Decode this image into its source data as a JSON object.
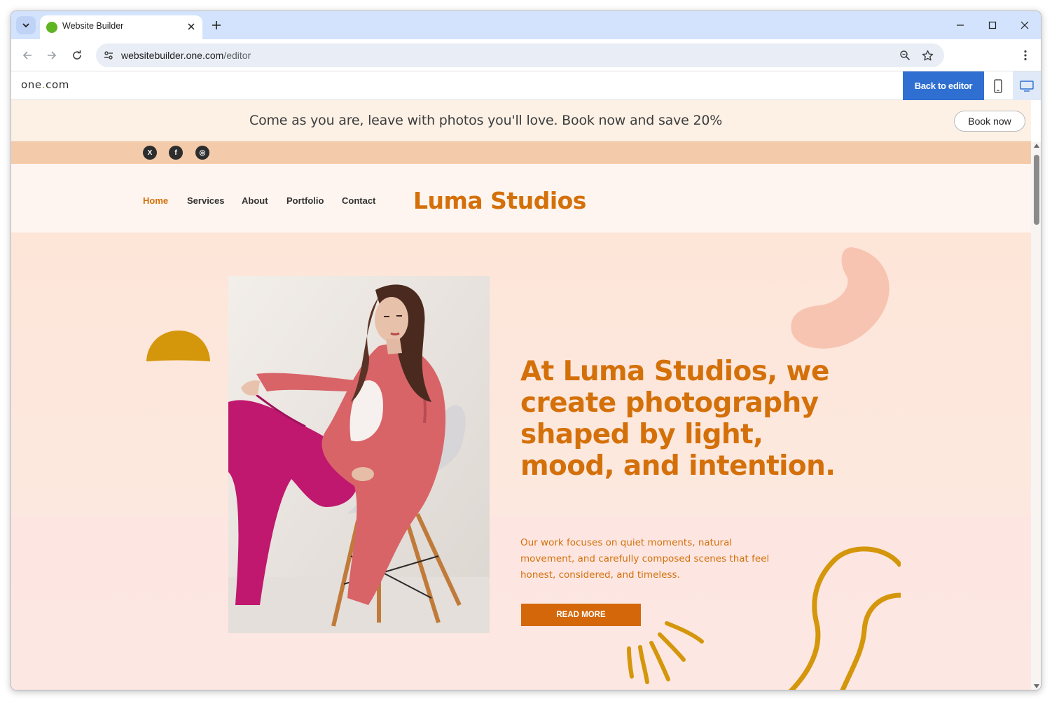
{
  "browser": {
    "tab_title": "Website Builder",
    "url_host": "websitebuilder.one.com",
    "url_path": "/editor"
  },
  "editor": {
    "brand_main": "one",
    "brand_dot": ".",
    "brand_tld": "com",
    "back_label": "Back to editor"
  },
  "site": {
    "promo_text": "Come as you are, leave with photos you'll love. Book now and save 20%",
    "promo_button": "Book now",
    "social": [
      {
        "icon": "x-icon",
        "glyph": "X"
      },
      {
        "icon": "facebook-icon",
        "glyph": "f"
      },
      {
        "icon": "instagram-icon",
        "glyph": "◎"
      }
    ],
    "nav": [
      "Home",
      "Services",
      "About",
      "Portfolio",
      "Contact"
    ],
    "logo": "Luma Studios",
    "hero_title": "At Luma Studios, we create photography shaped by light, mood, and intention.",
    "hero_desc": "Our work focuses on quiet moments, natural movement, and carefully composed scenes that feel honest, considered, and timeless.",
    "cta": "READ MORE"
  },
  "colors": {
    "accent": "#d4700a",
    "editor_blue": "#2e6fd1",
    "social_bar": "#f4cbaa",
    "mustard": "#d4960a"
  }
}
